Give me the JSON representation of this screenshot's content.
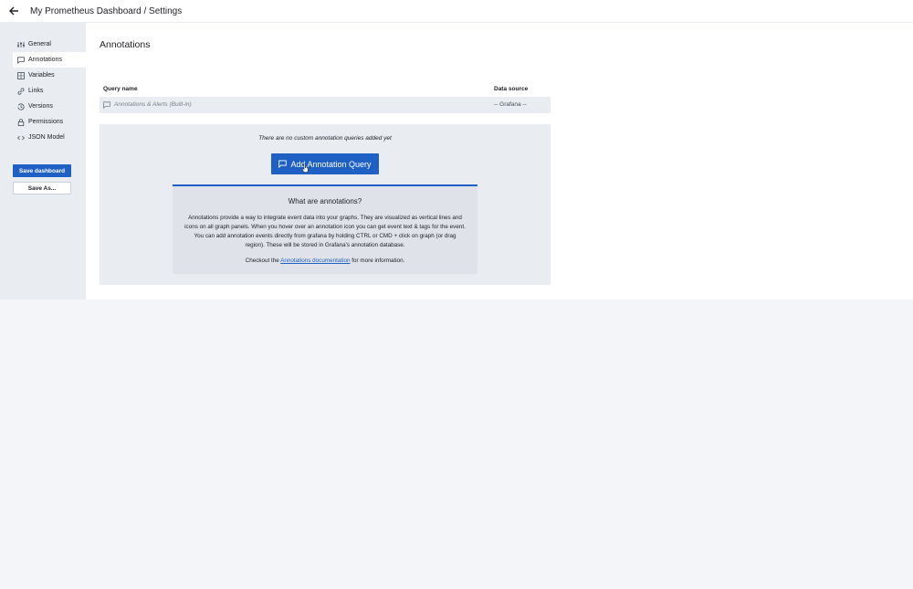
{
  "header": {
    "title": "My Prometheus Dashboard / Settings",
    "back_icon": "arrow-left-icon"
  },
  "sidebar": {
    "items": [
      {
        "label": "General",
        "icon": "sliders-icon",
        "active": false
      },
      {
        "label": "Annotations",
        "icon": "comment-icon",
        "active": true
      },
      {
        "label": "Variables",
        "icon": "variables-icon",
        "active": false
      },
      {
        "label": "Links",
        "icon": "link-icon",
        "active": false
      },
      {
        "label": "Versions",
        "icon": "history-icon",
        "active": false
      },
      {
        "label": "Permissions",
        "icon": "lock-icon",
        "active": false
      },
      {
        "label": "JSON Model",
        "icon": "code-icon",
        "active": false
      }
    ],
    "save_label": "Save dashboard",
    "save_as_label": "Save As..."
  },
  "main": {
    "heading": "Annotations",
    "table": {
      "col_name": "Query name",
      "col_datasource": "Data source",
      "rows": [
        {
          "name": "Annotations & Alerts (Built-in)",
          "datasource": "-- Grafana --"
        }
      ]
    },
    "empty": {
      "message": "There are no custom annotation queries added yet",
      "add_button": "Add Annotation Query",
      "info_title": "What are annotations?",
      "info_body": "Annotations provide a way to integrate event data into your graphs. They are visualized as vertical lines and icons on all graph panels. When you hover over an annotation icon you can get event text & tags for the event. You can add annotation events directly from grafana by holding CTRL or CMD + click on graph (or drag region). These will be stored in Grafana's annotation database.",
      "info_foot_prefix": "Checkout the ",
      "info_foot_link": "Annotations documentation",
      "info_foot_suffix": " for more information."
    }
  },
  "colors": {
    "primary": "#1f60c4",
    "sidebar_bg": "#e9edf2"
  }
}
